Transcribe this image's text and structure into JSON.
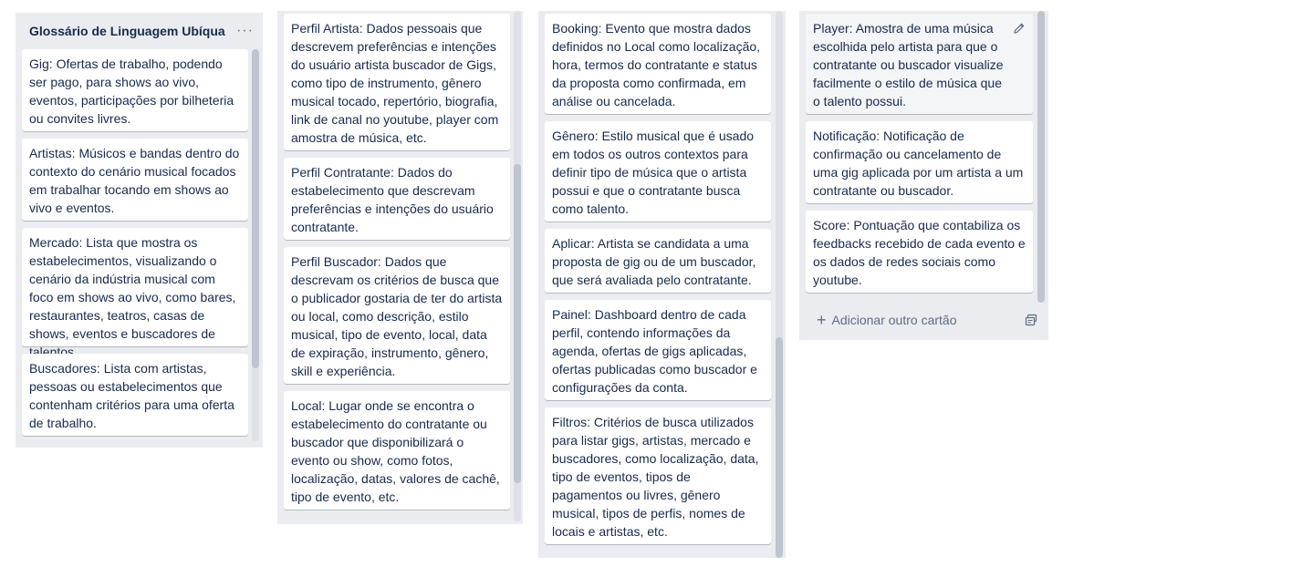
{
  "lists": [
    {
      "title": "Glossário de Linguagem Ubíqua",
      "menu_label": "···",
      "cards": [
        "Gig: Ofertas de trabalho, podendo ser pago, para shows ao vivo, eventos, participações por bilheteria ou convites livres.",
        "Artistas: Músicos e bandas dentro do contexto do cenário musical focados em trabalhar tocando em shows ao vivo e eventos.",
        "Mercado: Lista que mostra os estabelecimentos, visualizando o cenário da indústria musical com foco em shows ao vivo, como bares, restaurantes, teatros, casas de shows, eventos e buscadores de talentos.",
        "Buscadores: Lista com artistas, pessoas ou estabelecimentos que contenham critérios para uma oferta de trabalho."
      ]
    },
    {
      "cards": [
        "Perfil Artista: Dados pessoais que descrevem preferências e intenções do usuário artista buscador de Gigs, como tipo de instrumento, gênero musical tocado, repertório, biografia, link de canal no youtube, player com amostra de música, etc.",
        "Perfil Contratante: Dados do estabelecimento que descrevam preferências e intenções do usuário contratante.",
        "Perfil Buscador: Dados que descrevam os critérios de busca que o publicador gostaria de ter do artista ou local, como descrição, estilo musical, tipo de evento, local, data de expiração, instrumento, gênero, skill e experiência.",
        "Local: Lugar onde se encontra o estabelecimento do contratante ou buscador que disponibilizará o evento ou show, como fotos, localização, datas, valores de cachê, tipo de evento, etc."
      ]
    },
    {
      "cards": [
        "Booking: Evento que mostra dados definidos no Local como localização, hora, termos do contratante e status da proposta como confirmada, em análise ou cancelada.",
        "Gênero: Estilo musical que é usado em todos os outros contextos para definir tipo de música que o artista possui e que o contratante busca como talento.",
        "Aplicar: Artista se candidata a uma proposta de gig ou de um buscador, que será avaliada pelo contratante.",
        "Painel: Dashboard dentro de cada perfil, contendo informações da agenda, ofertas de gigs aplicadas, ofertas publicadas como buscador e configurações da conta.",
        "Filtros: Critérios de busca utilizados para listar gigs, artistas, mercado e buscadores, como localização, data, tipo de eventos, tipos de pagamentos ou livres, gênero musical, tipos de perfis, nomes de locais e artistas, etc."
      ]
    },
    {
      "cards": [
        "Player: Amostra de uma música escolhida pelo artista para que o contratante ou buscador visualize facilmente o estilo de música que o talento possui.",
        "Notificação: Notificação de confirmação ou cancelamento de uma gig aplicada por um artista a um contratante ou buscador.",
        "Score: Pontuação que contabiliza os feedbacks recebido de cada evento e os dados de redes sociais como youtube."
      ],
      "composer_label": "Adicionar outro cartão"
    }
  ],
  "icons": {
    "menu": "ellipsis-icon",
    "edit": "pencil-icon",
    "add": "plus-icon",
    "template": "card-template-icon"
  },
  "colors": {
    "list_bg": "#ebecf0",
    "card_bg": "#ffffff",
    "text": "#172b4d",
    "muted": "#5e6c84"
  }
}
